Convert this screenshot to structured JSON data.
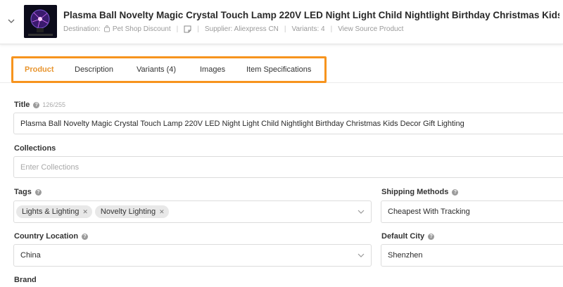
{
  "header": {
    "title": "Plasma Ball Novelty Magic Crystal Touch Lamp 220V LED Night Light Child Nightlight Birthday Christmas Kids Decor Gift L...",
    "destination_label": "Destination:",
    "destination_value": "Pet Shop Discount",
    "supplier": "Supplier: Aliexpress CN",
    "variants": "Variants: 4",
    "view_source": "View Source Product"
  },
  "tabs": [
    "Product",
    "Description",
    "Variants (4)",
    "Images",
    "Item Specifications"
  ],
  "form": {
    "title_label": "Title",
    "title_counter": "126/255",
    "title_value": "Plasma Ball Novelty Magic Crystal Touch Lamp 220V LED Night Light Child Nightlight Birthday Christmas Kids Decor Gift Lighting",
    "collections_label": "Collections",
    "collections_placeholder": "Enter Collections",
    "tags_label": "Tags",
    "tags": [
      "Lights & Lighting",
      "Novelty Lighting"
    ],
    "shipping_label": "Shipping Methods",
    "shipping_value": "Cheapest With Tracking",
    "country_label": "Country Location",
    "country_value": "China",
    "city_label": "Default City",
    "city_value": "Shenzhen",
    "brand_label": "Brand"
  },
  "colors": {
    "accent": "#e8952f",
    "highlight": "#f7941e"
  }
}
